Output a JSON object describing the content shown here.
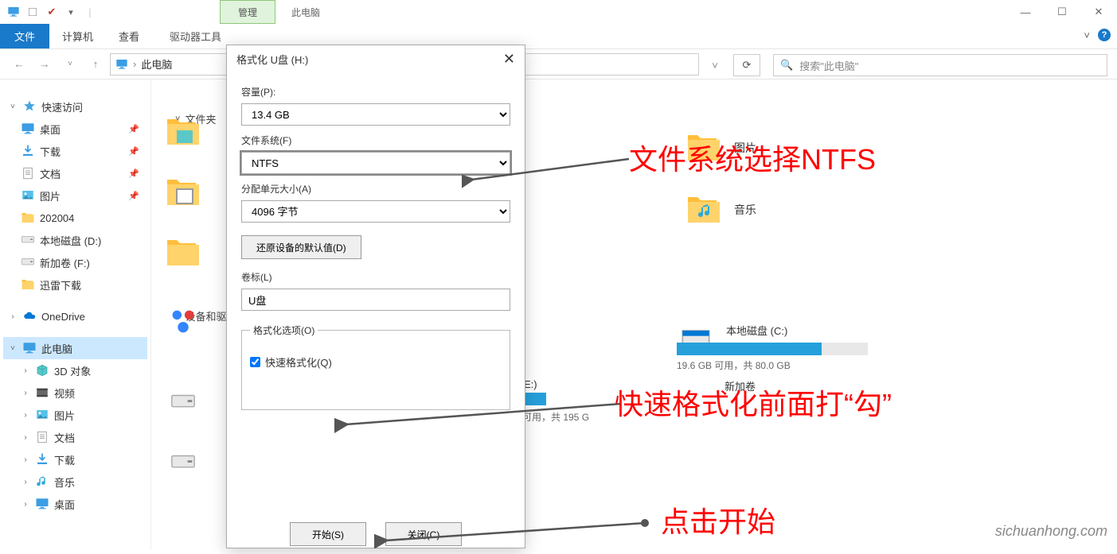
{
  "titlebar": {
    "contextual_tab": "管理",
    "window_subtitle": "此电脑"
  },
  "window_controls": {
    "minimize": "—",
    "maximize": "☐",
    "close": "✕"
  },
  "ribbon": {
    "file": "文件",
    "tabs": [
      "计算机",
      "查看"
    ],
    "contextual": "驱动器工具",
    "chevron": "˅"
  },
  "navbar": {
    "breadcrumb_root_icon": "monitor",
    "breadcrumb": "此电脑",
    "search_placeholder": "搜索\"此电脑\""
  },
  "tree": {
    "quick_access": "快速访问",
    "items_qa": [
      {
        "label": "桌面",
        "icon": "monitor",
        "pin": true
      },
      {
        "label": "下载",
        "icon": "download",
        "pin": true
      },
      {
        "label": "文档",
        "icon": "doc",
        "pin": true
      },
      {
        "label": "图片",
        "icon": "picture",
        "pin": true
      },
      {
        "label": "202004",
        "icon": "folder",
        "pin": false
      },
      {
        "label": "本地磁盘 (D:)",
        "icon": "drive",
        "pin": false
      },
      {
        "label": "新加卷 (F:)",
        "icon": "drive",
        "pin": false
      },
      {
        "label": "迅雷下载",
        "icon": "folder",
        "pin": false
      }
    ],
    "onedrive": "OneDrive",
    "this_pc": "此电脑",
    "items_pc": [
      {
        "label": "3D 对象",
        "icon": "cube"
      },
      {
        "label": "视频",
        "icon": "video"
      },
      {
        "label": "图片",
        "icon": "picture"
      },
      {
        "label": "文档",
        "icon": "doc"
      },
      {
        "label": "下载",
        "icon": "download"
      },
      {
        "label": "音乐",
        "icon": "music"
      },
      {
        "label": "桌面",
        "icon": "monitor"
      }
    ]
  },
  "content": {
    "group_folders": "文件夹",
    "group_devices": "设备和驱",
    "right": {
      "pictures_remnant": "图片",
      "music": "音乐",
      "driveC": {
        "name": "本地磁盘 (C:)",
        "info": "19.6 GB 可用，共 80.0 GB",
        "fill_pct": 76
      },
      "driveE_remnant": "E:)",
      "driveE_info_remnant": "可用，共 195 G",
      "driveNew_remnant": "新加卷"
    }
  },
  "modal": {
    "title": "格式化 U盘 (H:)",
    "capacity_label": "容量(P):",
    "capacity_value": "13.4 GB",
    "fs_label": "文件系统(F)",
    "fs_value": "NTFS",
    "alloc_label": "分配单元大小(A)",
    "alloc_value": "4096 字节",
    "restore_btn": "还原设备的默认值(D)",
    "vol_label": "卷标(L)",
    "vol_value": "U盘",
    "options_legend": "格式化选项(O)",
    "quick_format": "快速格式化(Q)",
    "start_btn": "开始(S)",
    "close_btn": "关闭(C)"
  },
  "annotations": {
    "a1": "文件系统选择NTFS",
    "a2": "快速格式化前面打“勾”",
    "a3": "点击开始"
  },
  "watermark": "sichuanhong.com"
}
